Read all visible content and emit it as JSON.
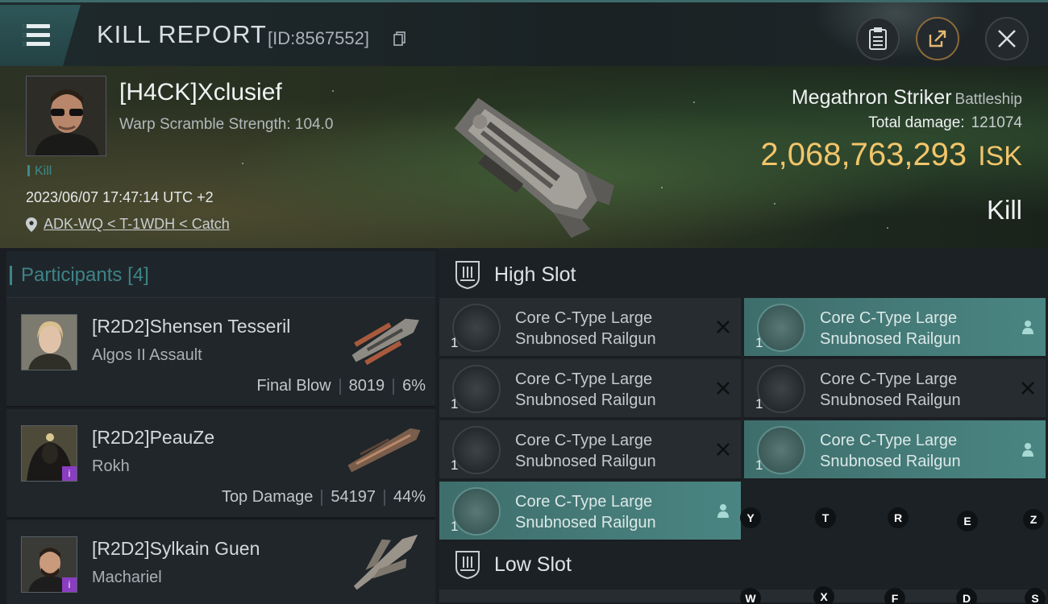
{
  "header": {
    "title": "KILL REPORT",
    "report_id": "[ID:8567552]"
  },
  "victim": {
    "name": "[H4CK]Xclusief",
    "subtitle": "Warp Scramble Strength: 104.0",
    "tag": "Kill",
    "timestamp": "2023/06/07 17:47:14 UTC +2",
    "location": "ADK-WQ < T-1WDH < Catch",
    "ship": "Megathron Striker",
    "ship_class": "Battleship",
    "damage_label": "Total damage:",
    "damage_value": "121074",
    "isk_value": "2,068,763,293",
    "isk_unit": "ISK",
    "result": "Kill"
  },
  "participants": {
    "label": "Participants",
    "count": "[4]",
    "rows": [
      {
        "name": "[R2D2]Shensen Tesseril",
        "ship": "Algos II Assault",
        "role": "Final Blow",
        "damage": "8019",
        "percent": "6%"
      },
      {
        "name": "[R2D2]PeauZe",
        "ship": "Rokh",
        "role": "Top Damage",
        "damage": "54197",
        "percent": "44%"
      },
      {
        "name": "[R2D2]Sylkain Guen",
        "ship": "Machariel"
      }
    ]
  },
  "slots": {
    "high": {
      "label": "High Slot",
      "modules": [
        {
          "line1": "Core C-Type Large",
          "line2": "Snubnosed Railgun",
          "qty": "1",
          "status": "destroyed"
        },
        {
          "line1": "Core C-Type Large",
          "line2": "Snubnosed Railgun",
          "qty": "1",
          "status": "dropped"
        },
        {
          "line1": "Core C-Type Large",
          "line2": "Snubnosed Railgun",
          "qty": "1",
          "status": "destroyed"
        },
        {
          "line1": "Core C-Type Large",
          "line2": "Snubnosed Railgun",
          "qty": "1",
          "status": "destroyed"
        },
        {
          "line1": "Core C-Type Large",
          "line2": "Snubnosed Railgun",
          "qty": "1",
          "status": "destroyed"
        },
        {
          "line1": "Core C-Type Large",
          "line2": "Snubnosed Railgun",
          "qty": "1",
          "status": "dropped"
        },
        {
          "line1": "Core C-Type Large",
          "line2": "Snubnosed Railgun",
          "qty": "1",
          "status": "dropped"
        }
      ]
    },
    "low": {
      "label": "Low Slot"
    }
  },
  "keyhints": {
    "row1": [
      "Y",
      "T",
      "R",
      "E",
      "Z"
    ],
    "row2": [
      "W",
      "X",
      "F",
      "D",
      "S"
    ]
  },
  "colors": {
    "accent": "#3e8487",
    "isk": "#f2c56a",
    "fitted": "#4a8582",
    "badge": "#8a3dc0"
  }
}
